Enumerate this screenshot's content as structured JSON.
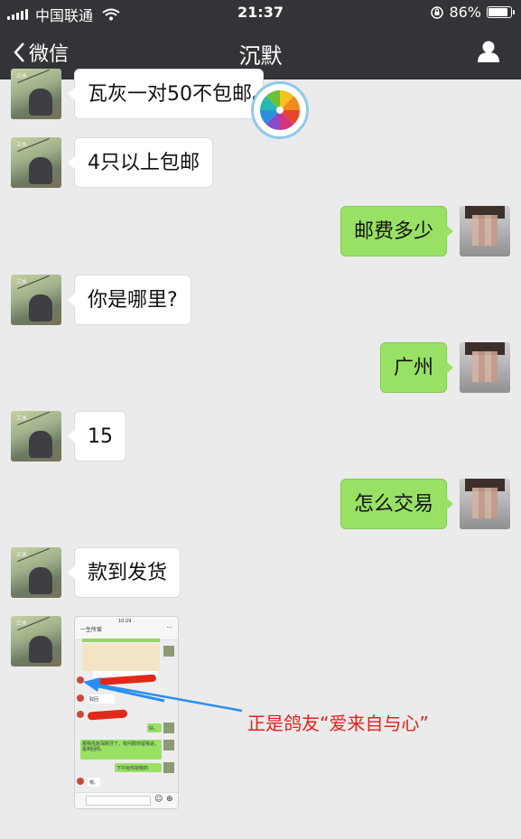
{
  "status_bar": {
    "carrier": "中国联通",
    "time": "21:37",
    "battery": "86%",
    "battery_level": 0.86
  },
  "nav": {
    "back_label": "微信",
    "title": "沉默",
    "back_icon": "chevron-left-icon",
    "profile_icon": "user-icon"
  },
  "messages": [
    {
      "side": "left",
      "text": "瓦灰一对50不包邮。"
    },
    {
      "side": "left",
      "text": "4只以上包邮"
    },
    {
      "side": "right",
      "text": "邮费多少"
    },
    {
      "side": "left",
      "text": "你是哪里?"
    },
    {
      "side": "right",
      "text": "广州"
    },
    {
      "side": "left",
      "text": "15"
    },
    {
      "side": "right",
      "text": "怎么交易"
    },
    {
      "side": "left",
      "text": "款到发货"
    }
  ],
  "embedded_screenshot": {
    "header_title": "一生所爱",
    "time": "10:29",
    "msg_fragment_1": "好。",
    "msg_fragment_2": "那我先赵深刷牙了。有问题你留我说，看到回你。",
    "msg_fragment_3": "下午给你拍我的",
    "msg_fragment_4": "嗯。",
    "msg_fragment_5": "取回"
  },
  "annotation": "正是鸽友“爱来自与心”",
  "colors": {
    "header_bg": "#333438",
    "chat_bg": "#ebebeb",
    "bubble_right": "#98e165",
    "bubble_left": "#ffffff",
    "annotation_red": "#e3211c",
    "arrow_blue": "#2a8ff0"
  }
}
